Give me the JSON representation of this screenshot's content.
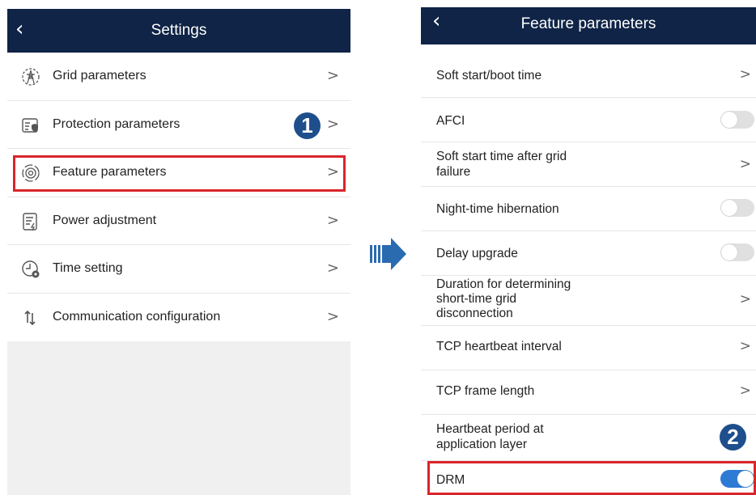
{
  "left": {
    "back_icon": "chevron-left-icon",
    "title": "Settings",
    "items": [
      {
        "label": "Grid parameters",
        "icon": "grid-tower-icon"
      },
      {
        "label": "Protection parameters",
        "icon": "protection-list-icon"
      },
      {
        "label": "Feature parameters",
        "icon": "feature-settings-icon"
      },
      {
        "label": "Power adjustment",
        "icon": "power-adjust-icon"
      },
      {
        "label": "Time setting",
        "icon": "clock-gear-icon"
      },
      {
        "label": "Communication configuration",
        "icon": "communication-arrows-icon"
      }
    ],
    "chevron": ">"
  },
  "steps": {
    "one": "1",
    "two": "2"
  },
  "right": {
    "back_icon": "chevron-left-icon",
    "title": "Feature parameters",
    "chevron": ">",
    "items": [
      {
        "label": "Soft start/boot time",
        "control": "chevron"
      },
      {
        "label": "AFCI",
        "control": "toggle",
        "state": "off"
      },
      {
        "label": "Soft start time after grid\nfailure",
        "control": "chevron"
      },
      {
        "label": "Night-time hibernation",
        "control": "toggle",
        "state": "off"
      },
      {
        "label": "Delay upgrade",
        "control": "toggle",
        "state": "off"
      },
      {
        "label": "Duration for determining\nshort-time grid\ndisconnection",
        "control": "chevron"
      },
      {
        "label": "TCP heartbeat interval",
        "control": "chevron"
      },
      {
        "label": "TCP frame length",
        "control": "chevron"
      },
      {
        "label": "Heartbeat period at\napplication layer",
        "control": "none"
      },
      {
        "label": "DRM",
        "control": "toggle",
        "state": "on"
      }
    ]
  },
  "colors": {
    "header": "#0f2446",
    "highlight": "#d9252b",
    "badge": "#1e4f8c",
    "toggle_on": "#2e7bd6",
    "arrow": "#2a6bb0"
  }
}
